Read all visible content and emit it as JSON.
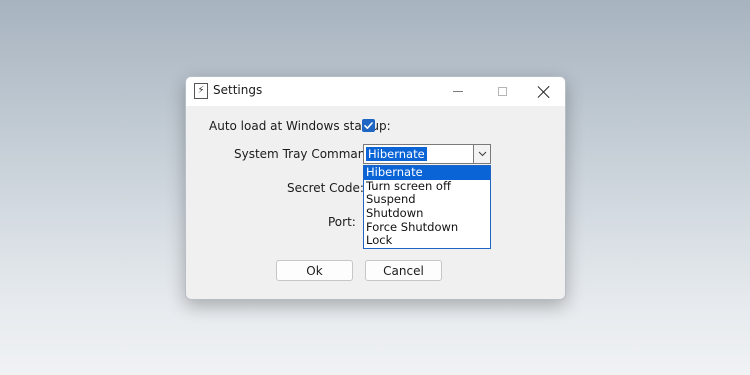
{
  "window": {
    "title": "Settings",
    "app_icon_glyph": "⚡",
    "controls": [
      "minimize",
      "maximize",
      "close"
    ]
  },
  "form": {
    "auto_load_label": "Auto load at Windows startup:",
    "auto_load_checked": true,
    "tray_command_label": "System Tray Command:",
    "tray_command_value": "Hibernate",
    "secret_code_label": "Secret Code:",
    "port_label": "Port:"
  },
  "dropdown": {
    "options": [
      "Hibernate",
      "Turn screen off",
      "Suspend",
      "Shutdown",
      "Force Shutdown",
      "Lock"
    ],
    "selected_index": 0
  },
  "buttons": {
    "ok_label": "Ok",
    "cancel_label": "Cancel"
  },
  "colors": {
    "accent": "#0a64d6",
    "checkbox": "#1f66c4"
  }
}
